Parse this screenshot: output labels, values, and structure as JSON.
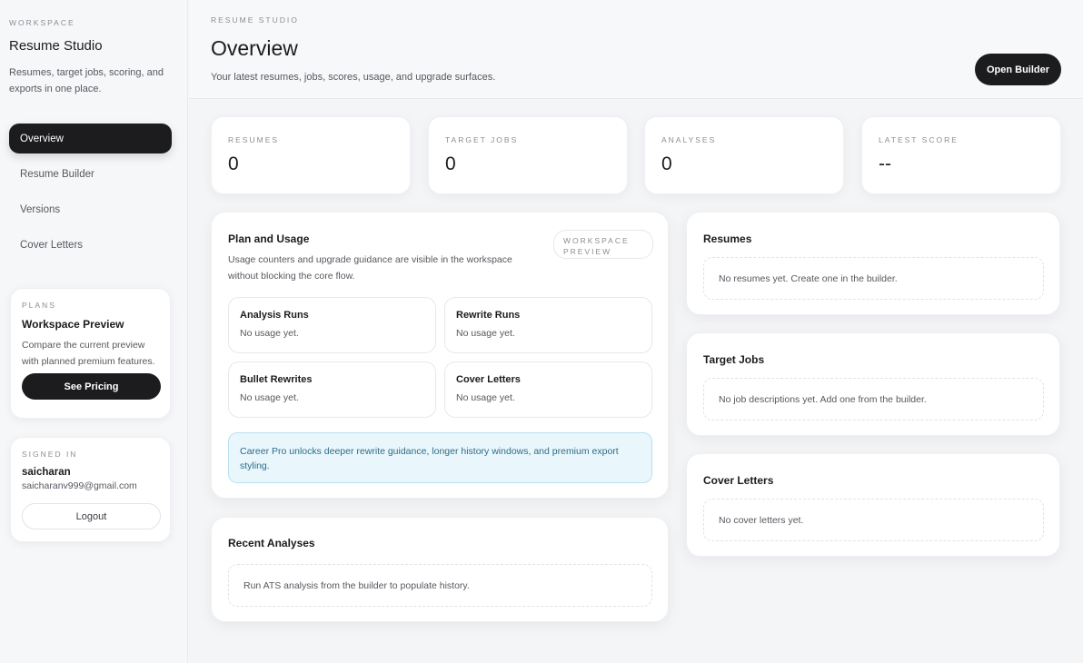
{
  "sidebar": {
    "eyebrow": "WORKSPACE",
    "title": "Resume Studio",
    "description": "Resumes, target jobs, scoring, and exports in one place.",
    "nav": [
      {
        "label": "Overview",
        "active": true
      },
      {
        "label": "Resume Builder",
        "active": false
      },
      {
        "label": "Versions",
        "active": false
      },
      {
        "label": "Cover Letters",
        "active": false
      }
    ],
    "plans": {
      "eyebrow": "PLANS",
      "title": "Workspace Preview",
      "description": "Compare the current preview with planned premium features.",
      "button_label": "See Pricing"
    },
    "account": {
      "eyebrow": "SIGNED IN",
      "username": "saicharan",
      "email": "saicharanv999@gmail.com",
      "logout_label": "Logout"
    }
  },
  "header": {
    "eyebrow": "RESUME STUDIO",
    "title": "Overview",
    "subtitle": "Your latest resumes, jobs, scores, usage, and upgrade surfaces.",
    "open_builder_label": "Open Builder"
  },
  "stats": [
    {
      "label": "RESUMES",
      "value": "0"
    },
    {
      "label": "TARGET JOBS",
      "value": "0"
    },
    {
      "label": "ANALYSES",
      "value": "0"
    },
    {
      "label": "LATEST SCORE",
      "value": "--"
    }
  ],
  "plan_usage": {
    "title": "Plan and Usage",
    "description": "Usage counters and upgrade guidance are visible in the workspace without blocking the core flow.",
    "badge": "WORKSPACE PREVIEW",
    "counters": [
      {
        "title": "Analysis Runs",
        "value": "No usage yet."
      },
      {
        "title": "Rewrite Runs",
        "value": "No usage yet."
      },
      {
        "title": "Bullet Rewrites",
        "value": "No usage yet."
      },
      {
        "title": "Cover Letters",
        "value": "No usage yet."
      }
    ],
    "upgrade_note": "Career Pro unlocks deeper rewrite guidance, longer history windows, and premium export styling."
  },
  "recent_analyses": {
    "title": "Recent Analyses",
    "empty_text": "Run ATS analysis from the builder to populate history."
  },
  "resumes": {
    "title": "Resumes",
    "empty_text": "No resumes yet. Create one in the builder."
  },
  "target_jobs": {
    "title": "Target Jobs",
    "empty_text": "No job descriptions yet. Add one from the builder."
  },
  "cover_letters": {
    "title": "Cover Letters",
    "empty_text": "No cover letters yet."
  },
  "colors": {
    "accent_dark": "#1c1c1e",
    "info_bg": "#e9f6fb",
    "info_text": "#2f6d8a"
  }
}
